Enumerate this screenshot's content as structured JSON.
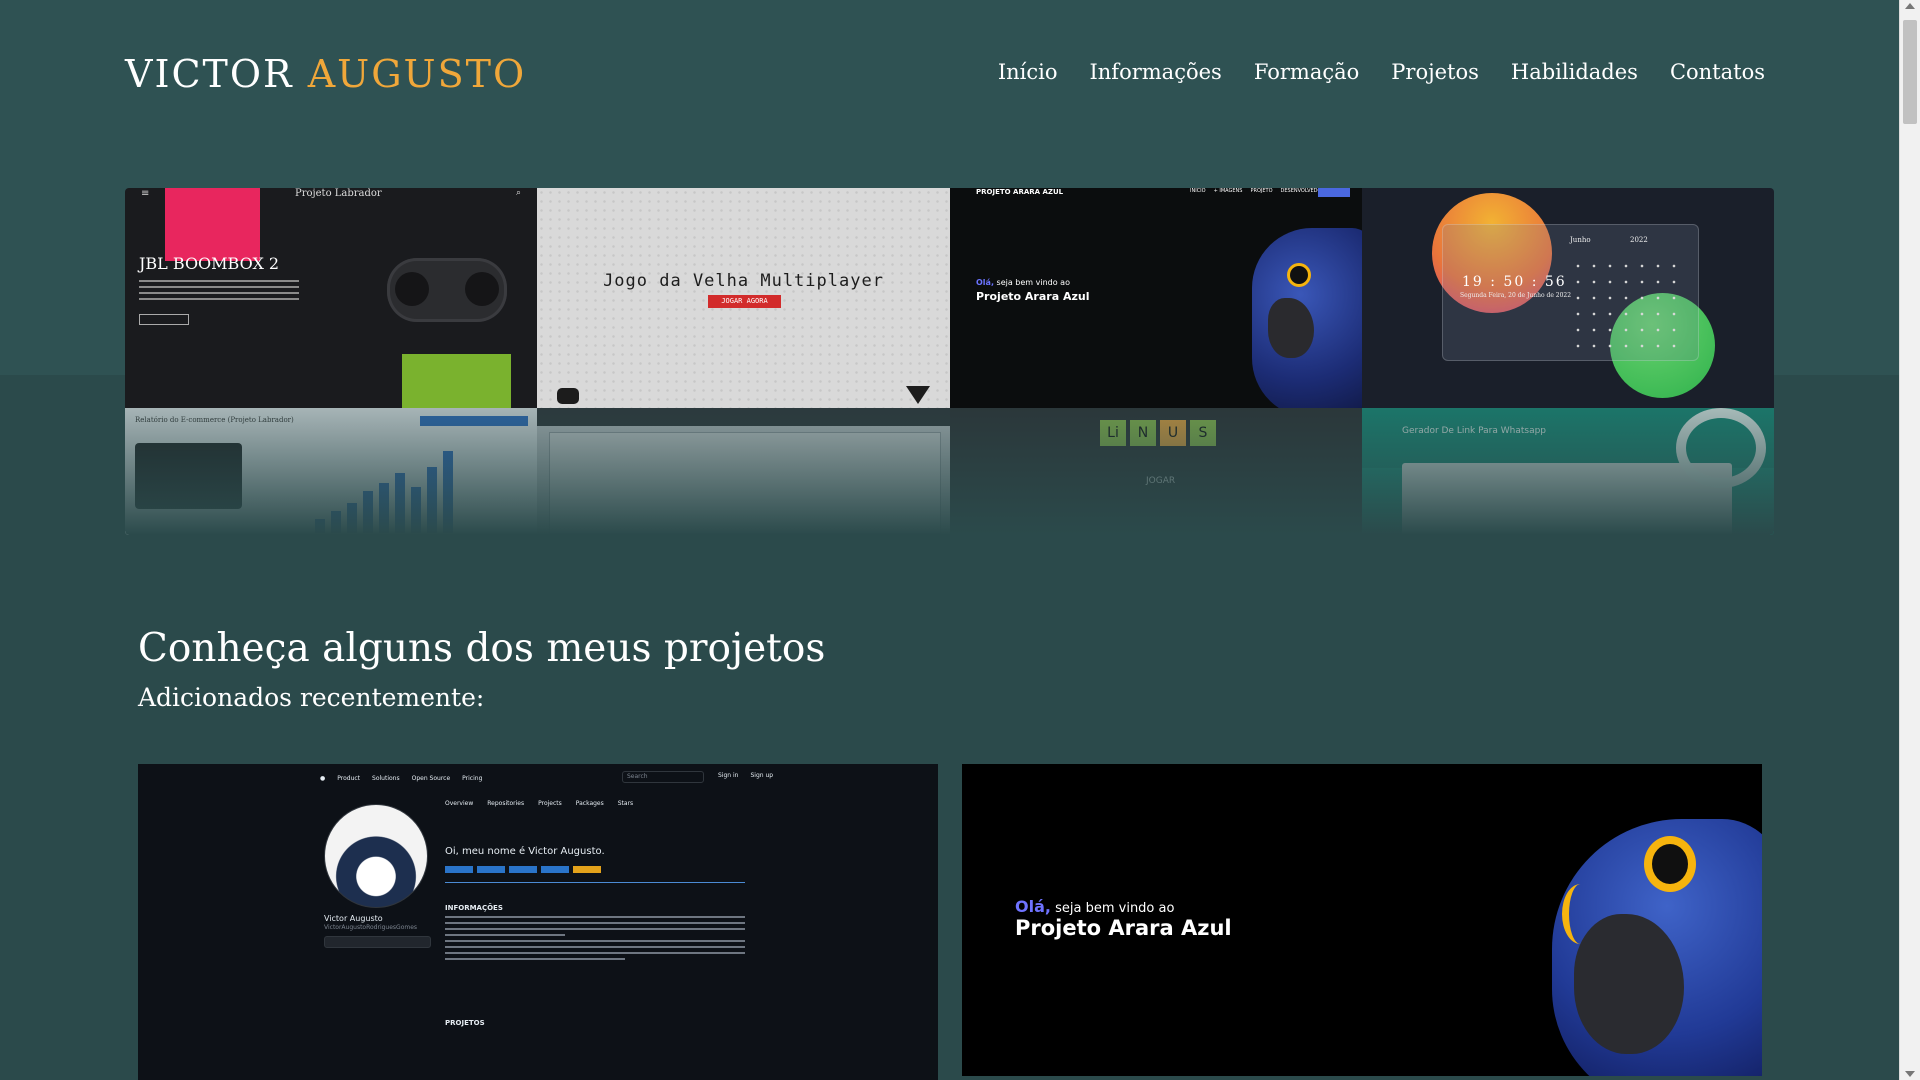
{
  "header": {
    "logo_first": "VICTOR",
    "logo_last": "AUGUSTO",
    "nav": [
      "Início",
      "Informações",
      "Formação",
      "Projetos",
      "Habilidades",
      "Contatos"
    ]
  },
  "gallery": {
    "jbl": {
      "brand": "Projeto Labrador",
      "title": "JBL BOOMBOX 2",
      "menu_icon": "menu-icon",
      "search_icon": "search-icon"
    },
    "velha": {
      "title": "Jogo da Velha Multiplayer",
      "button": "JOGAR AGORA"
    },
    "arara": {
      "header": "PROJETO ARARA AZUL",
      "links": [
        "INÍCIO",
        "+ IMAGENS",
        "PROJETO",
        "DESENVOLVEDOR"
      ],
      "hello": "Olá,",
      "welcome": "seja bem vindo ao",
      "name": "Projeto Arara Azul"
    },
    "calendar": {
      "time": "19 : 50 : 56",
      "date": "Segunda Feira, 20 de Junho de 2022",
      "month": "Junho",
      "year": "2022"
    },
    "ecommerce": {
      "header": "Relatório do E-commerce (Projeto Labrador)",
      "bars": [
        0.12,
        0.18,
        0.25,
        0.35,
        0.42,
        0.5,
        0.38,
        0.55,
        0.68
      ]
    },
    "linus": {
      "letters": [
        "Li",
        "N",
        "U",
        "S"
      ],
      "play": "JOGAR"
    },
    "whatsapp": {
      "title": "Gerador De Link Para Whatsapp"
    }
  },
  "section": {
    "title": "Conheça alguns dos meus projetos",
    "subtitle": "Adicionados recentemente:"
  },
  "github_card": {
    "menu": [
      "Product",
      "Solutions",
      "Open Source",
      "Pricing"
    ],
    "search_placeholder": "Search",
    "sign_in": "Sign in",
    "sign_up": "Sign up",
    "tabs": [
      "Overview",
      "Repositories",
      "Projects",
      "Packages",
      "Stars"
    ],
    "name": "Victor Augusto",
    "username": "VictorAugustoRodriguesGomes",
    "hello": "Oi, meu nome é Victor Augusto.",
    "info_heading": "INFORMAÇÕES",
    "projects_heading": "PROJETOS"
  },
  "arara_card": {
    "hello": "Olá,",
    "welcome": "seja bem vindo ao",
    "name": "Projeto Arara Azul"
  },
  "colors": {
    "background_top": "#2f5253",
    "background_bottom": "#2b4a4b",
    "accent": "#f0a73a"
  }
}
